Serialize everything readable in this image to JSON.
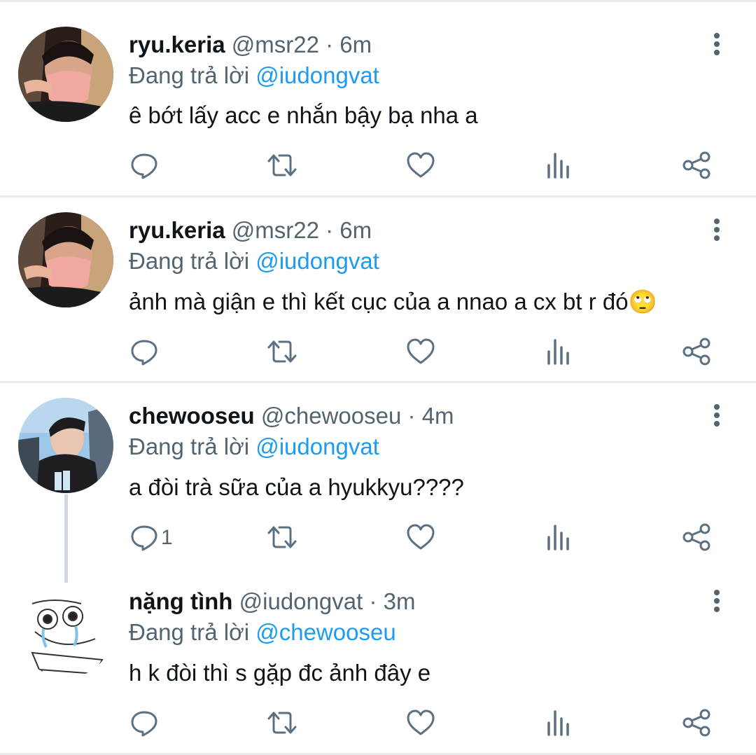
{
  "tweets": [
    {
      "name": "ryu.keria",
      "handle": "@msr22",
      "sep": "·",
      "time": "6m",
      "reply_prefix": "Đang trả lời",
      "reply_to": "@iudongvat",
      "text": "ê bớt lấy acc e nhắn bậy bạ nha a",
      "reply_count": ""
    },
    {
      "name": "ryu.keria",
      "handle": "@msr22",
      "sep": "·",
      "time": "6m",
      "reply_prefix": "Đang trả lời",
      "reply_to": "@iudongvat",
      "text": "ảnh mà giận e thì kết cục của a nnao a cx bt r đó🙄",
      "reply_count": ""
    },
    {
      "name": "chewooseu",
      "handle": "@chewooseu",
      "sep": "·",
      "time": "4m",
      "reply_prefix": "Đang trả lời",
      "reply_to": "@iudongvat",
      "text": "a đòi trà sữa của a hyukkyu????",
      "reply_count": "1"
    },
    {
      "name": "nặng tình",
      "handle": "@iudongvat",
      "sep": "·",
      "time": "3m",
      "reply_prefix": "Đang trả lời",
      "reply_to": "@chewooseu",
      "text": "h k đòi thì s gặp đc ảnh đây e",
      "reply_count": ""
    }
  ],
  "icons": [
    "reply-icon",
    "retweet-icon",
    "like-icon",
    "analytics-icon",
    "share-icon",
    "more-icon"
  ],
  "colors": {
    "accent": "#1d9bf0",
    "secondary": "#536471",
    "icon": "#5b7083",
    "divider": "#e6ecf0"
  }
}
